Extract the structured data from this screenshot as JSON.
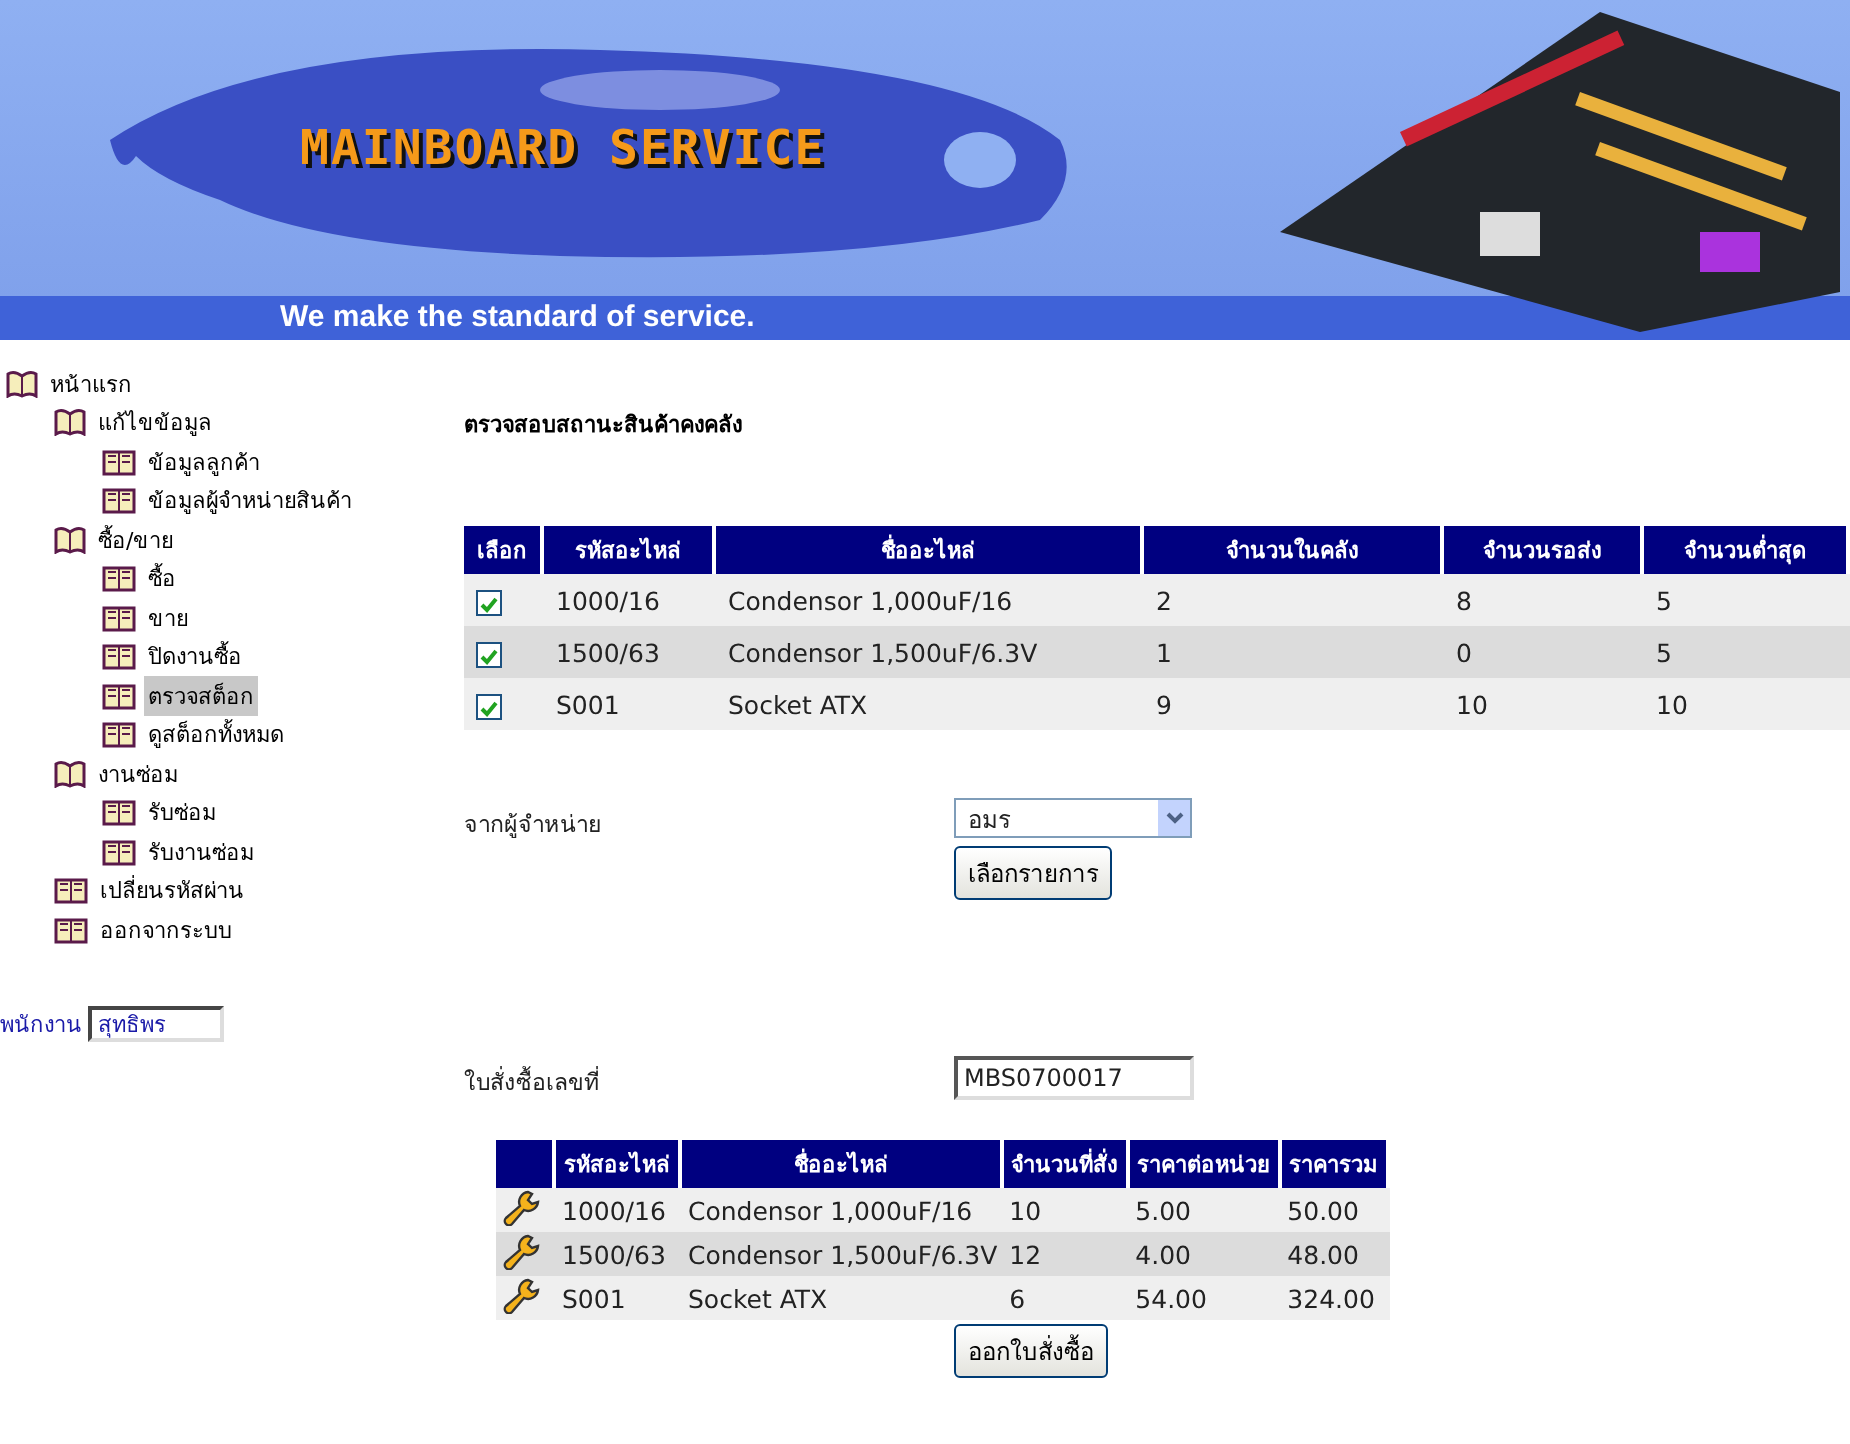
{
  "banner": {
    "title": "MAINBOARD SERVICE",
    "tagline": "We make the standard of service."
  },
  "sidebar": {
    "items": [
      {
        "label": "หน้าแรก",
        "kind": "folder",
        "selected": false,
        "children": [
          {
            "label": "แก้ไขข้อมูล",
            "kind": "folder",
            "selected": false,
            "children": [
              {
                "label": "ข้อมูลลูกค้า",
                "kind": "page",
                "selected": false
              },
              {
                "label": "ข้อมูลผู้จำหน่ายสินค้า",
                "kind": "page",
                "selected": false
              }
            ]
          },
          {
            "label": "ซื้อ/ขาย",
            "kind": "folder",
            "selected": false,
            "children": [
              {
                "label": "ซื้อ",
                "kind": "page",
                "selected": false
              },
              {
                "label": "ขาย",
                "kind": "page",
                "selected": false
              },
              {
                "label": "ปิดงานซื้อ",
                "kind": "page",
                "selected": false
              },
              {
                "label": "ตรวจสต็อก",
                "kind": "page",
                "selected": true
              },
              {
                "label": "ดูสต็อกทั้งหมด",
                "kind": "page",
                "selected": false
              }
            ]
          },
          {
            "label": "งานซ่อม",
            "kind": "folder",
            "selected": false,
            "children": [
              {
                "label": "รับซ่อม",
                "kind": "page",
                "selected": false
              },
              {
                "label": "รับงานซ่อม",
                "kind": "page",
                "selected": false
              }
            ]
          },
          {
            "label": "เปลี่ยนรหัสผ่าน",
            "kind": "page",
            "selected": false
          },
          {
            "label": "ออกจากระบบ",
            "kind": "page",
            "selected": false
          }
        ]
      }
    ],
    "employee": {
      "label": "พนักงาน",
      "value": "สุทธิพร"
    }
  },
  "stock": {
    "title": "ตรวจสอบสถานะสินค้าคงคลัง",
    "columns": [
      "เลือก",
      "รหัสอะไหล่",
      "ชื่ออะไหล่",
      "จำนวนในคลัง",
      "จำนวนรอส่ง",
      "จำนวนต่ำสุด"
    ],
    "rows": [
      [
        {
          "checked": true
        },
        "1000/16",
        "Condensor 1,000uF/16",
        "2",
        "8",
        "5"
      ],
      [
        {
          "checked": true
        },
        "1500/63",
        "Condensor 1,500uF/6.3V",
        "1",
        "0",
        "5"
      ],
      [
        {
          "checked": true
        },
        "S001",
        "Socket ATX",
        "9",
        "10",
        "10"
      ]
    ]
  },
  "supplier": {
    "label": "จากผู้จำหน่าย",
    "value": "อมร",
    "button": "เลือกรายการ"
  },
  "order": {
    "label": "ใบสั่งซื้อเลขที่",
    "value": "MBS0700017",
    "columns": [
      "รหัสอะไหล่",
      "ชื่ออะไหล่",
      "จำนวนที่สั่ง",
      "ราคาต่อหน่วย",
      "ราคารวม"
    ],
    "rows": [
      [
        "1000/16",
        "Condensor 1,000uF/16",
        "10",
        "5.00",
        "50.00"
      ],
      [
        "1500/63",
        "Condensor 1,500uF/6.3V",
        "12",
        "4.00",
        "48.00"
      ],
      [
        "S001",
        "Socket ATX",
        "6",
        "54.00",
        "324.00"
      ]
    ],
    "button": "ออกใบสั่งซื้อ"
  }
}
